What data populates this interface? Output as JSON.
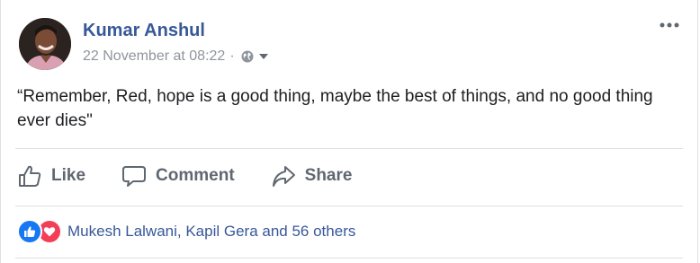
{
  "post": {
    "author": "Kumar Anshul",
    "timestamp": "22 November at 08:22",
    "separator": "·",
    "audience_icon": "globe-icon",
    "text": "“Remember, Red, hope is a good thing, maybe the best of things, and no good thing ever dies\""
  },
  "actions": {
    "like": "Like",
    "comment": "Comment",
    "share": "Share"
  },
  "reactions": {
    "summary": "Mukesh Lalwani, Kapil Gera and 56 others",
    "types": [
      "like",
      "love"
    ]
  },
  "colors": {
    "name": "#385898",
    "meta": "#90949c",
    "action": "#606770",
    "like": "#1877f2",
    "love": "#f33e58"
  }
}
